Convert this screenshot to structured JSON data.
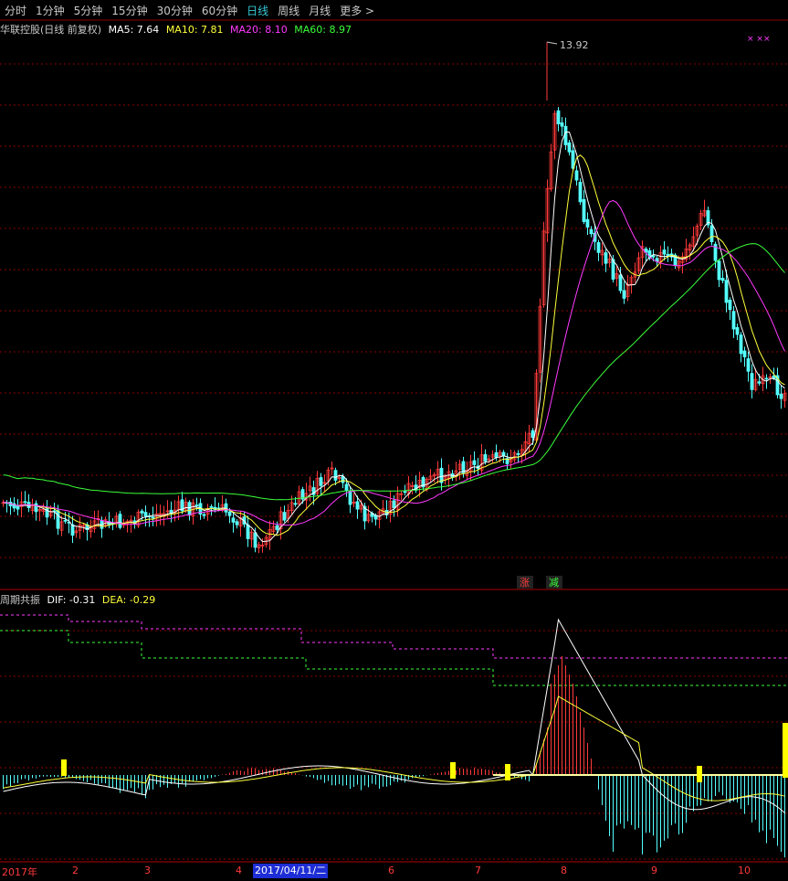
{
  "timeframe_tabs": [
    {
      "label": "分时",
      "active": false
    },
    {
      "label": "1分钟",
      "active": false
    },
    {
      "label": "5分钟",
      "active": false
    },
    {
      "label": "15分钟",
      "active": false
    },
    {
      "label": "30分钟",
      "active": false
    },
    {
      "label": "60分钟",
      "active": false
    },
    {
      "label": "日线",
      "active": true
    },
    {
      "label": "周线",
      "active": false
    },
    {
      "label": "月线",
      "active": false
    },
    {
      "label": "更多 >",
      "active": false
    }
  ],
  "main_panel": {
    "title": "华联控股(日线 前复权)",
    "ma5_label": "MA5: 7.64",
    "ma10_label": "MA10: 7.81",
    "ma20_label": "MA20: 8.10",
    "ma60_label": "MA60: 8.97",
    "peak_label": "13.92",
    "marker_up": "涨",
    "marker_down": "减",
    "corner_marks": "×   ××"
  },
  "sub_panel": {
    "title": "周期共振",
    "dif_label": "DIF: -0.31",
    "dea_label": "DEA: -0.29"
  },
  "x_axis": {
    "labels": [
      {
        "text": "2017年"
      },
      {
        "text": "2"
      },
      {
        "text": "3"
      },
      {
        "text": "4"
      },
      {
        "text": "6"
      },
      {
        "text": "7"
      },
      {
        "text": "8"
      },
      {
        "text": "9"
      },
      {
        "text": "10"
      }
    ],
    "cursor_date": "2017/04/11/二"
  },
  "colors": {
    "up": "#ff3a3a",
    "down": "#54ffff",
    "ma5": "#ffffff",
    "ma10": "#ffff3a",
    "ma20": "#ff3aff",
    "ma60": "#3aff3a",
    "grid": "#8a0000",
    "active_tab": "#35c9d6"
  }
}
